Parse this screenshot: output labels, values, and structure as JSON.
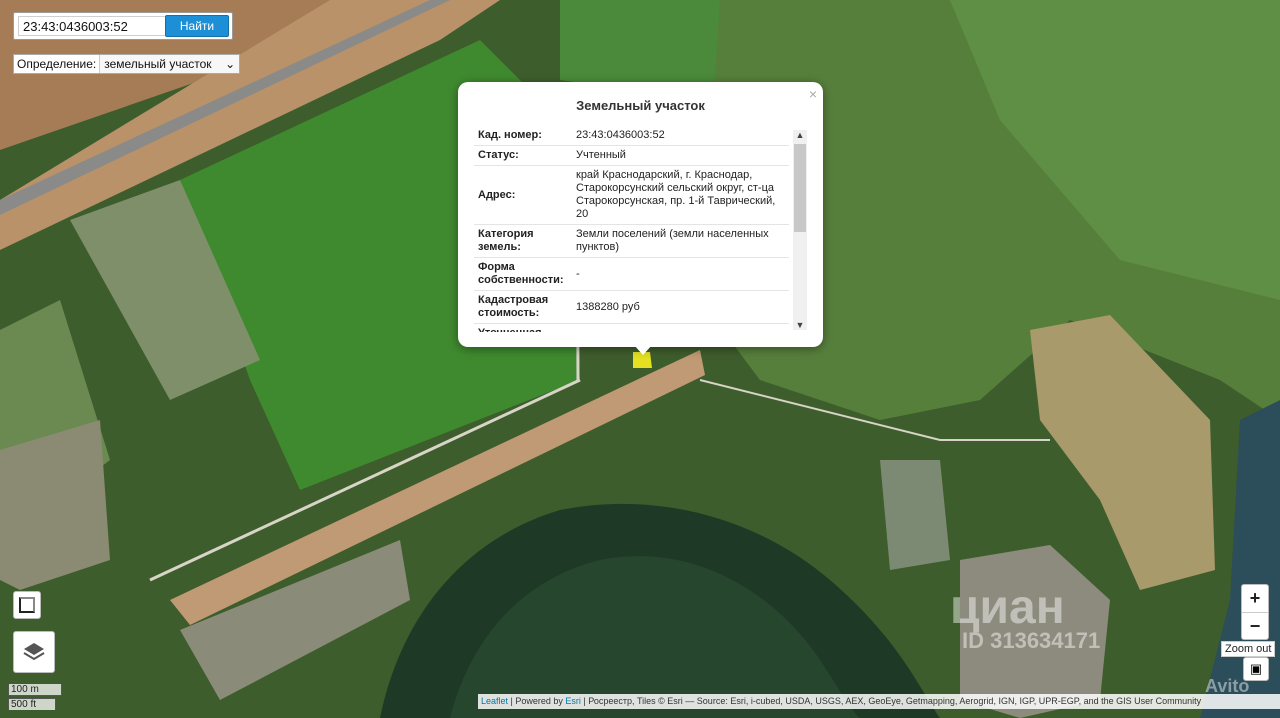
{
  "search": {
    "value": "23:43:0436003:52",
    "button": "Найти"
  },
  "definition": {
    "label": "Определение:",
    "selected": "земельный участок"
  },
  "popup": {
    "title": "Земельный участок",
    "close": "×",
    "rows": [
      {
        "k": "Кад. номер:",
        "v": "23:43:0436003:52"
      },
      {
        "k": "Статус:",
        "v": "Учтенный"
      },
      {
        "k": "Адрес:",
        "v": "край Краснодарский, г. Краснодар, Старокорсунский сельский округ, ст-ца Старокорсунская, пр. 1-й Таврический, 20"
      },
      {
        "k": "Категория земель:",
        "v": "Земли поселений (земли населенных пунктов)"
      },
      {
        "k": "Форма собственности:",
        "v": "-"
      },
      {
        "k": "Кадастровая стоимость:",
        "v": "1388280 руб"
      },
      {
        "k": "Уточненная",
        "v": ""
      }
    ]
  },
  "zoom": {
    "in": "+",
    "out": "−",
    "tooltip": "Zoom out"
  },
  "scale": {
    "metric": "100 m",
    "imperial": "500 ft"
  },
  "attribution": {
    "leaflet": "Leaflet",
    "text1": " | Powered by ",
    "esri": "Esri",
    "text2": " | Росреестр, Tiles © Esri — Source: Esri, i-cubed, USDA, USGS, AEX, GeoEye, Getmapping, Aerogrid, IGN, IGP, UPR-EGP, and the GIS User Community"
  },
  "watermarks": {
    "cian_brand": "циан",
    "cian_id": "ID 313634171",
    "avito": "Avito"
  },
  "colors": {
    "accent": "#1c8fd6",
    "field": "#3d7a34",
    "water": "#1f3a2a",
    "parcel": "#e5e021"
  }
}
